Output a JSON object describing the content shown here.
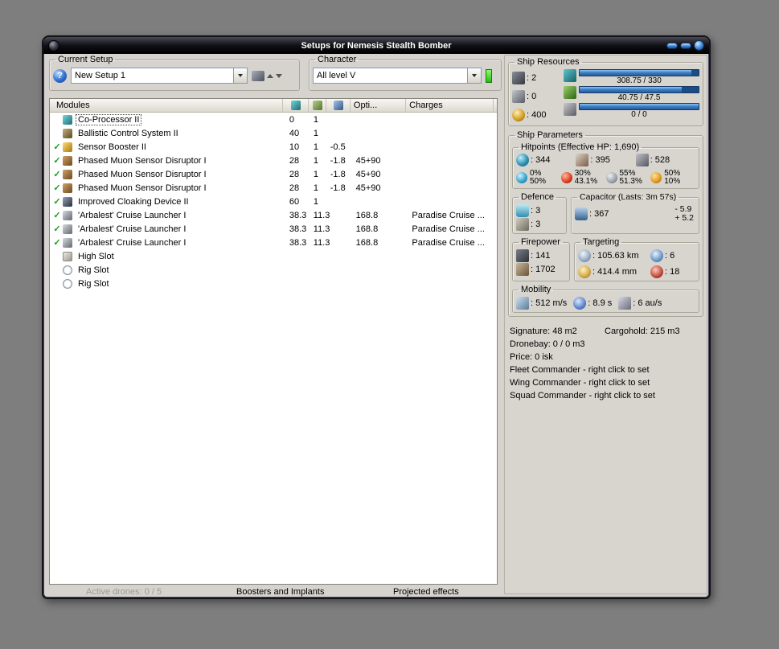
{
  "colors": {
    "accent_blue": "#3a7cc4",
    "check_green": "#18a018",
    "indicator_green": "#3ddc3d",
    "titlebar_black": "#000000"
  },
  "window": {
    "title": "Setups for Nemesis Stealth Bomber"
  },
  "current_setup": {
    "label": "Current Setup",
    "value": "New Setup 1",
    "help": "?"
  },
  "character": {
    "label": "Character",
    "value": "All level V"
  },
  "modules_table": {
    "name_header": "Modules",
    "opti_header": "Opti...",
    "charges_header": "Charges",
    "rows": [
      {
        "icon": "coprocessor-icon",
        "name": "Co-Processor II",
        "cpu": "0",
        "pg": "1",
        "cap": "",
        "opti": "",
        "charge": "",
        "check": "",
        "selected": true
      },
      {
        "icon": "ballistic-control-icon",
        "name": "Ballistic Control System II",
        "cpu": "40",
        "pg": "1",
        "cap": "",
        "opti": "",
        "charge": "",
        "check": ""
      },
      {
        "icon": "sensor-booster-icon",
        "name": "Sensor Booster II",
        "cpu": "10",
        "pg": "1",
        "cap": "-0.5",
        "opti": "",
        "charge": "",
        "check": "✓"
      },
      {
        "icon": "sensor-disruptor-icon",
        "name": "Phased Muon Sensor Disruptor I",
        "cpu": "28",
        "pg": "1",
        "cap": "-1.8",
        "opti": "45+90",
        "charge": "",
        "check": "✓"
      },
      {
        "icon": "sensor-disruptor-icon",
        "name": "Phased Muon Sensor Disruptor I",
        "cpu": "28",
        "pg": "1",
        "cap": "-1.8",
        "opti": "45+90",
        "charge": "",
        "check": "✓"
      },
      {
        "icon": "sensor-disruptor-icon",
        "name": "Phased Muon Sensor Disruptor I",
        "cpu": "28",
        "pg": "1",
        "cap": "-1.8",
        "opti": "45+90",
        "charge": "",
        "check": "✓"
      },
      {
        "icon": "cloak-icon",
        "name": "Improved Cloaking Device II",
        "cpu": "60",
        "pg": "1",
        "cap": "",
        "opti": "",
        "charge": "",
        "check": "✓"
      },
      {
        "icon": "cruise-launcher-icon",
        "name": "'Arbalest' Cruise Launcher I",
        "cpu": "38.3",
        "pg": "11.3",
        "cap": "",
        "opti": "168.8",
        "charge": "Paradise Cruise ...",
        "check": "✓"
      },
      {
        "icon": "cruise-launcher-icon",
        "name": "'Arbalest' Cruise Launcher I",
        "cpu": "38.3",
        "pg": "11.3",
        "cap": "",
        "opti": "168.8",
        "charge": "Paradise Cruise ...",
        "check": "✓"
      },
      {
        "icon": "cruise-launcher-icon",
        "name": "'Arbalest' Cruise Launcher I",
        "cpu": "38.3",
        "pg": "11.3",
        "cap": "",
        "opti": "168.8",
        "charge": "Paradise Cruise ...",
        "check": "✓"
      },
      {
        "icon": "high-slot-icon",
        "name": "High Slot",
        "cpu": "",
        "pg": "",
        "cap": "",
        "opti": "",
        "charge": "",
        "check": ""
      },
      {
        "icon": "rig-slot-icon",
        "name": "Rig Slot",
        "cpu": "",
        "pg": "",
        "cap": "",
        "opti": "",
        "charge": "",
        "check": ""
      },
      {
        "icon": "rig-slot-icon",
        "name": "Rig Slot",
        "cpu": "",
        "pg": "",
        "cap": "",
        "opti": "",
        "charge": "",
        "check": ""
      }
    ]
  },
  "footer": {
    "active_drones": "Active drones: 0 / 5",
    "boosters": "Boosters and Implants",
    "projected": "Projected effects"
  },
  "ship_resources": {
    "label": "Ship Resources",
    "turrets": "2",
    "launchers": "0",
    "calibration": "400",
    "cpu_text": "308.75 / 330",
    "cpu_pct": 94,
    "pg_text": "40.75 / 47.5",
    "pg_pct": 86,
    "drone_text": "0 / 0",
    "drone_pct": 100
  },
  "ship_parameters": {
    "label": "Ship Parameters",
    "hitpoints": {
      "label": "Hitpoints (Effective HP: 1,690)",
      "shield": "344",
      "armor": "395",
      "structure": "528",
      "resists": [
        {
          "top": "0%",
          "bottom": "50%"
        },
        {
          "top": "30%",
          "bottom": "43.1%"
        },
        {
          "top": "55%",
          "bottom": "51.3%"
        },
        {
          "top": "50%",
          "bottom": "10%"
        }
      ]
    },
    "defence": {
      "label": "Defence",
      "shield_rate": "3",
      "armor_rate": "3"
    },
    "capacitor": {
      "label": "Capacitor (Lasts: 3m 57s)",
      "amount": "367",
      "drain": "- 5.9",
      "recharge": "+ 5.2"
    },
    "firepower": {
      "label": "Firepower",
      "dps": "141",
      "volley": "1702"
    },
    "targeting": {
      "label": "Targeting",
      "range": "105.63 km",
      "max_targets": "6",
      "scan_resolution": "414.4 mm",
      "sensor_strength": "18"
    },
    "mobility": {
      "label": "Mobility",
      "speed": "512 m/s",
      "align_time": "8.9 s",
      "warp_speed": "6 au/s"
    }
  },
  "info": {
    "signature": "Signature: 48 m2",
    "cargohold": "Cargohold: 215 m3",
    "dronebay": "Dronebay: 0 / 0 m3",
    "price": "Price: 0 isk",
    "fleet": "Fleet Commander - right click to set",
    "wing": "Wing Commander - right click to set",
    "squad": "Squad Commander - right click to set"
  }
}
